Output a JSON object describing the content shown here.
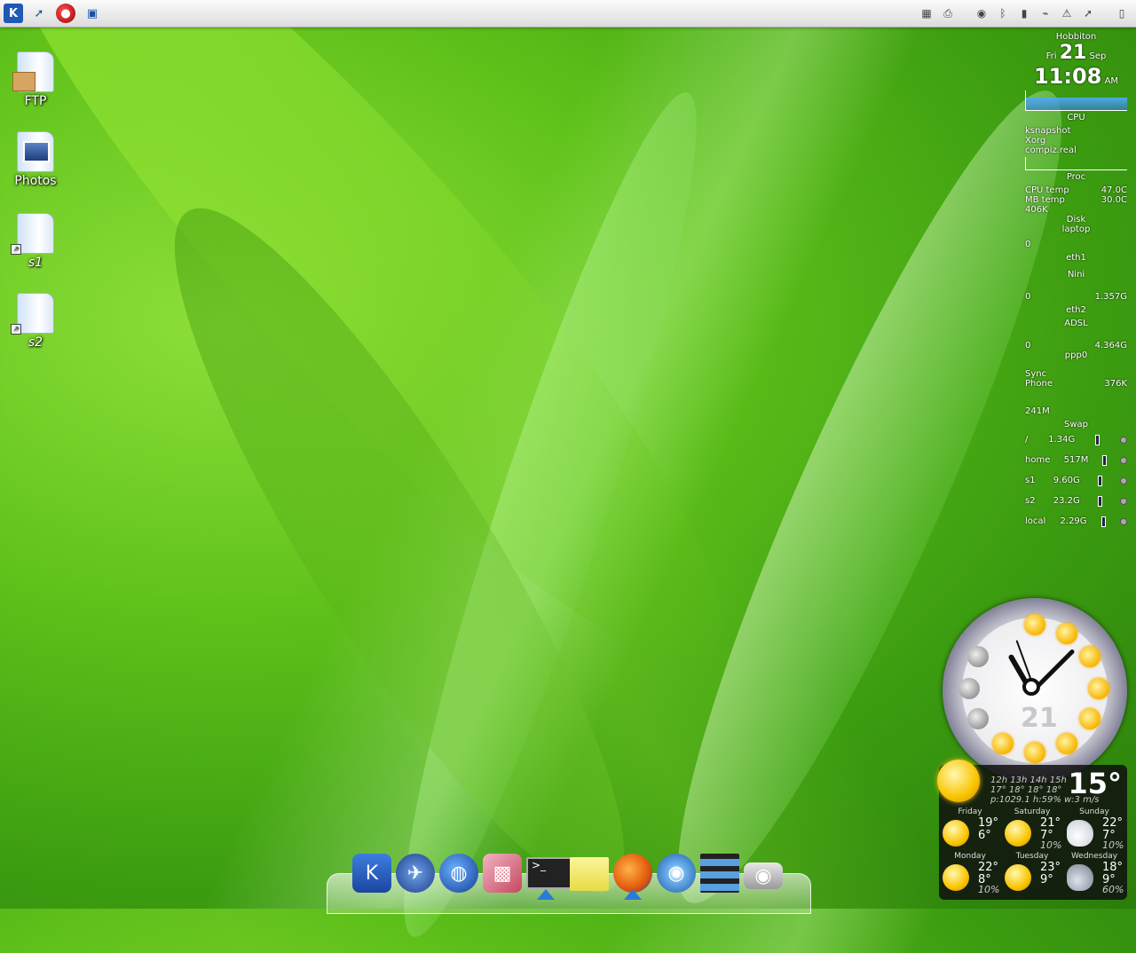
{
  "desktop": {
    "icons": [
      {
        "label": "FTP"
      },
      {
        "label": "Photos"
      },
      {
        "label": "s1"
      },
      {
        "label": "s2"
      }
    ]
  },
  "panel": {
    "launchers": [
      "kde-menu-icon",
      "cursor-icon",
      "red-app-icon",
      "computer-icon"
    ],
    "tray": [
      "pager-icon",
      "printer-icon",
      "eye-icon",
      "bluetooth-icon",
      "battery-icon",
      "network-icon",
      "warning-icon",
      "cursor-icon",
      "panel-hide-icon"
    ]
  },
  "sysmon": {
    "host": "Hobbiton",
    "weekday": "Fri",
    "day": "21",
    "month": "Sep",
    "time": "11:08",
    "ampm": "AM",
    "cpu_label": "CPU",
    "procs": [
      "ksnapshot",
      "Xorg",
      "compiz.real"
    ],
    "proc_label": "Proc",
    "cpu_temp_label": "CPU temp",
    "cpu_temp": "47.0C",
    "mb_temp_label": "MB temp",
    "mb_temp": "30.0C",
    "disk_rate": "406K",
    "disk_label": "Disk",
    "laptop_label": "laptop",
    "zero1": "0",
    "eth1_label": "eth1",
    "nini_label": "Nini",
    "zero2": "0",
    "eth1_total": "1.357G",
    "eth2_label": "eth2",
    "adsl_label": "ADSL",
    "zero3": "0",
    "ppp0_total": "4.364G",
    "ppp0_label": "ppp0",
    "sync_label": "Sync",
    "phone_label": "Phone",
    "phone_value": "376K",
    "swap_total": "241M",
    "swap_label": "Swap",
    "filesystems": [
      {
        "name": "/",
        "size": "1.34G"
      },
      {
        "name": "home",
        "size": "517M"
      },
      {
        "name": "s1",
        "size": "9.60G"
      },
      {
        "name": "s2",
        "size": "23.2G"
      },
      {
        "name": "local",
        "size": "2.29G"
      }
    ]
  },
  "clock": {
    "date": "21"
  },
  "weather": {
    "temp": "15°",
    "hours": "12h 13h 14h 15h",
    "hour_temps": "17° 18° 18° 18°",
    "details": "p:1029.1  h:59%  w:3 m/s",
    "days": [
      {
        "name": "Friday",
        "hi": "19°",
        "lo": "6°",
        "precip": "",
        "icon": "sun"
      },
      {
        "name": "Saturday",
        "hi": "21°",
        "lo": "7°",
        "precip": "10%",
        "icon": "sun"
      },
      {
        "name": "Sunday",
        "hi": "22°",
        "lo": "7°",
        "precip": "10%",
        "icon": "partly-cloudy"
      },
      {
        "name": "Monday",
        "hi": "22°",
        "lo": "8°",
        "precip": "10%",
        "icon": "sun"
      },
      {
        "name": "Tuesday",
        "hi": "23°",
        "lo": "9°",
        "precip": "",
        "icon": "sun"
      },
      {
        "name": "Wednesday",
        "hi": "18°",
        "lo": "9°",
        "precip": "60%",
        "icon": "rain"
      }
    ]
  },
  "dock": {
    "items": [
      "kde-icon",
      "browser-globe-icon",
      "google-earth-icon",
      "package-box-icon",
      "terminal-icon",
      "sticky-note-icon",
      "firefox-icon",
      "media-player-icon",
      "film-icon",
      "camera-icon"
    ]
  }
}
